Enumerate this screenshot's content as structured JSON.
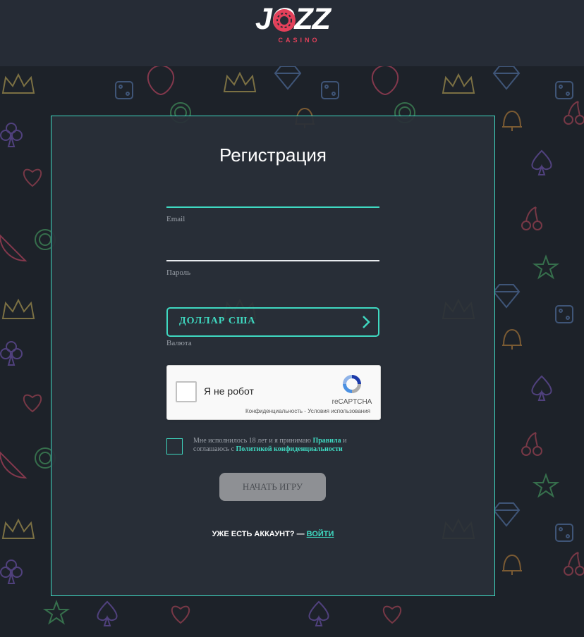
{
  "logo": {
    "word": "JOZZ",
    "sub": "CASINO"
  },
  "form": {
    "title": "Регистрация",
    "email_label": "Email",
    "password_label": "Пароль",
    "currency_value": "ДОЛЛАР США",
    "currency_label": "Валюта",
    "captcha": {
      "checkbox_text": "Я не робот",
      "brand": "reCAPTCHA",
      "links": "Конфиденциальность - Условия использования"
    },
    "agreement": {
      "text1": "Мне исполнилось 18 лет и я принимаю ",
      "rules_link": "Правила",
      "text2": " и соглашаюсь с ",
      "privacy_link": "Политикой конфиденциальности"
    },
    "start_button": "НАЧАТЬ ИГРУ",
    "have_account": "УЖЕ ЕСТЬ АККАУНТ? — ",
    "login_link": "ВОЙТИ"
  },
  "colors": {
    "accent": "#3fd9c1",
    "brand_red": "#e3405a",
    "header_bg": "#262c36",
    "panel_bg": "#292f38"
  },
  "icons": [
    "casino-chip-icon",
    "chevron-right-icon",
    "recaptcha-icon"
  ]
}
